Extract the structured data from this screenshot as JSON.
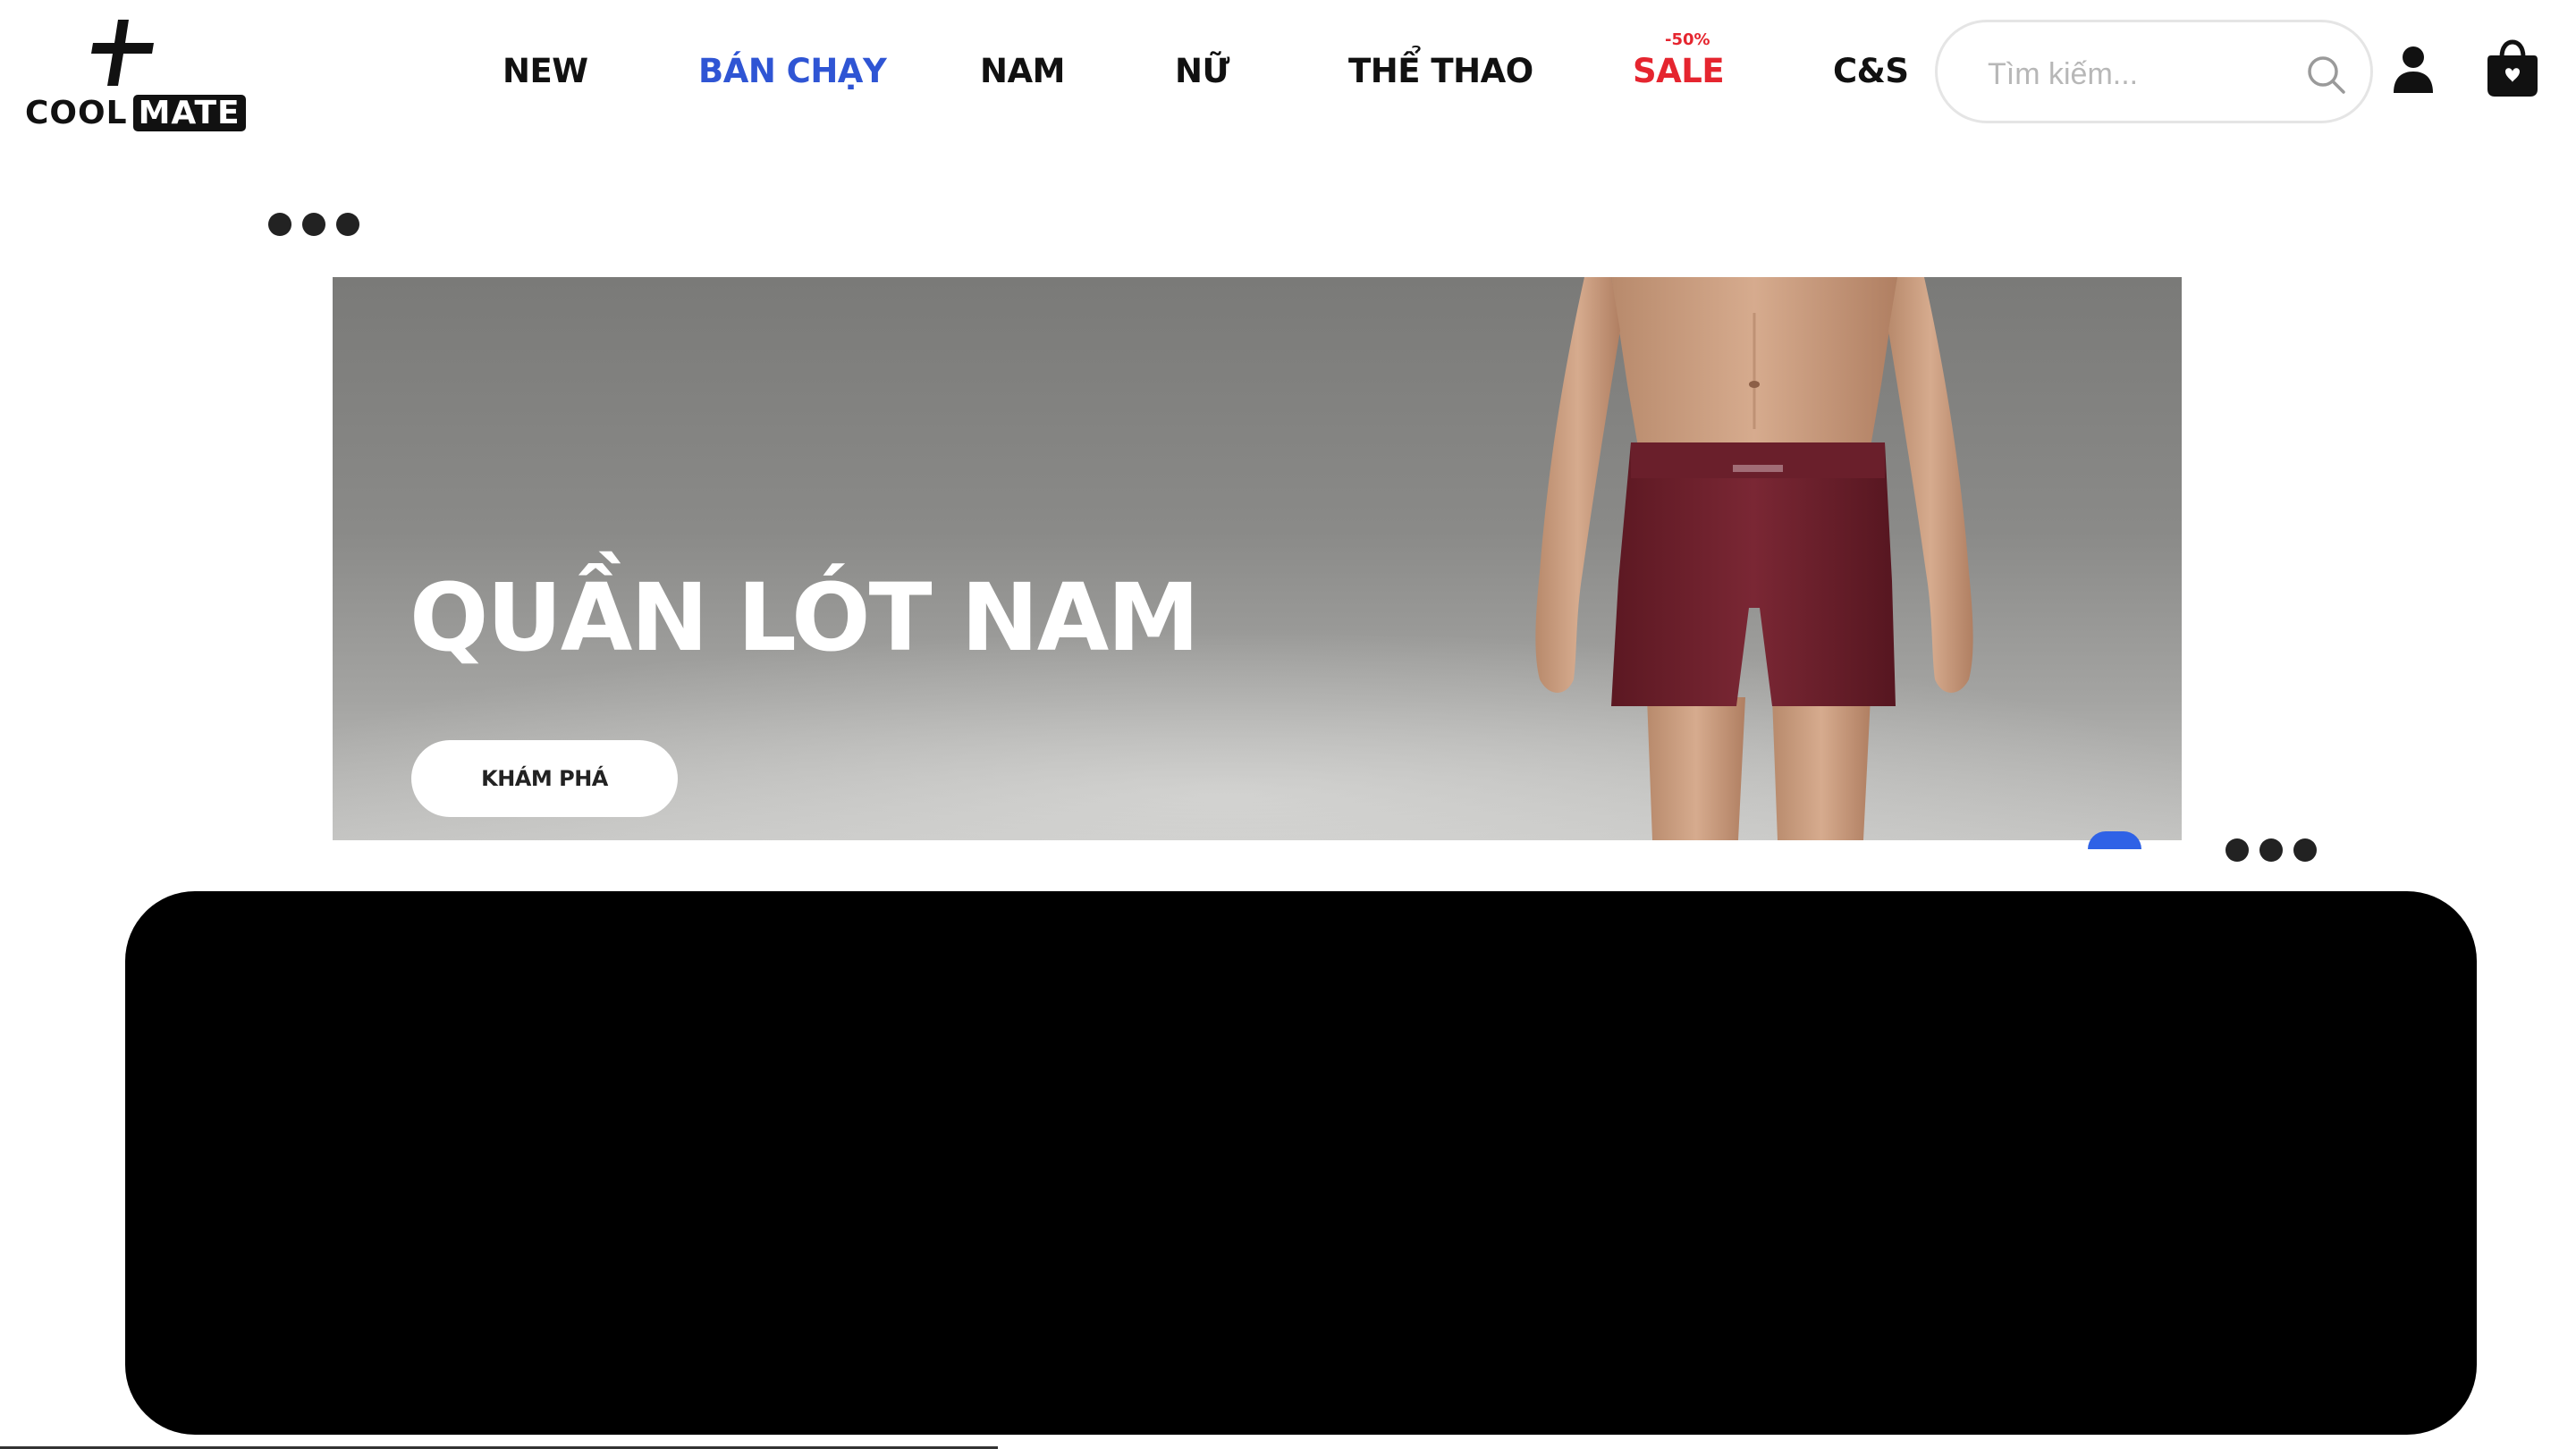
{
  "brand": {
    "logo_word_1": "COOL",
    "logo_word_2": "MATE"
  },
  "nav": {
    "items": [
      {
        "label": "NEW"
      },
      {
        "label": "BÁN CHẠY",
        "active": true
      },
      {
        "label": "NAM"
      },
      {
        "label": "NỮ"
      },
      {
        "label": "THỂ THAO"
      },
      {
        "label": "SALE",
        "badge": "-50%"
      },
      {
        "label": "C&S"
      }
    ],
    "active_color": "#2f55d4",
    "sale_color": "#e5252f"
  },
  "search": {
    "placeholder": "Tìm kiếm...",
    "value": ""
  },
  "icons": {
    "search": "search-icon",
    "user": "user-icon",
    "cart": "shopping-bag-icon",
    "more": "more-dots-icon"
  },
  "banner": {
    "title": "QUẦN LÓT NAM",
    "cta": "KHÁM PHÁ",
    "product_color": "#6e1f2b"
  }
}
